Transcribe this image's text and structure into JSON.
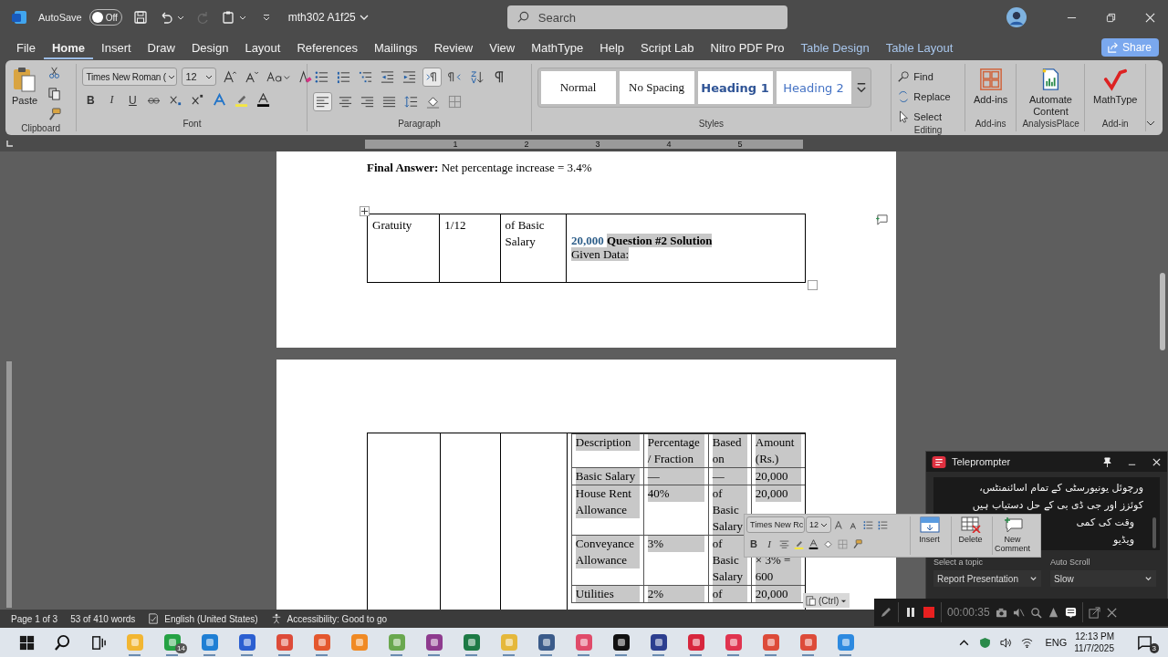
{
  "title_bar": {
    "autosave_label": "AutoSave",
    "autosave_on": false,
    "autosave_state": "Off",
    "redo_disabled": true,
    "document_name": "mth302 A1f25",
    "search_placeholder": "Search"
  },
  "tabs": [
    {
      "label": "File",
      "selected": false,
      "kind": "main"
    },
    {
      "label": "Home",
      "selected": true,
      "kind": "main"
    },
    {
      "label": "Insert",
      "selected": false,
      "kind": "main"
    },
    {
      "label": "Draw",
      "selected": false,
      "kind": "main"
    },
    {
      "label": "Design",
      "selected": false,
      "kind": "main"
    },
    {
      "label": "Layout",
      "selected": false,
      "kind": "main"
    },
    {
      "label": "References",
      "selected": false,
      "kind": "main"
    },
    {
      "label": "Mailings",
      "selected": false,
      "kind": "main"
    },
    {
      "label": "Review",
      "selected": false,
      "kind": "main"
    },
    {
      "label": "View",
      "selected": false,
      "kind": "main"
    },
    {
      "label": "MathType",
      "selected": false,
      "kind": "main"
    },
    {
      "label": "Help",
      "selected": false,
      "kind": "main"
    },
    {
      "label": "Script Lab",
      "selected": false,
      "kind": "main"
    },
    {
      "label": "Nitro PDF Pro",
      "selected": false,
      "kind": "main"
    },
    {
      "label": "Table Design",
      "selected": false,
      "kind": "contextual"
    },
    {
      "label": "Table Layout",
      "selected": false,
      "kind": "contextual"
    }
  ],
  "share_label": "Share",
  "ribbon": {
    "clipboard": {
      "paste_label": "Paste",
      "group_label": "Clipboard"
    },
    "font": {
      "font_name": "Times New Roman (",
      "font_size": "12",
      "bold": "B",
      "italic": "I",
      "underline": "U",
      "group_label": "Font"
    },
    "paragraph": {
      "group_label": "Paragraph",
      "align_left_on": true,
      "ltr_on": true
    },
    "styles": {
      "items": [
        {
          "label": "Normal",
          "kind": "normal"
        },
        {
          "label": "No Spacing",
          "kind": "normal"
        },
        {
          "label": "Heading 1",
          "kind": "heading1"
        },
        {
          "label": "Heading 2",
          "kind": "heading2"
        }
      ],
      "group_label": "Styles"
    },
    "editing": {
      "find": "Find",
      "replace": "Replace",
      "select": "Select",
      "group_label": "Editing"
    },
    "addins": [
      {
        "label": "Add-ins",
        "group": "Add-ins",
        "kind": "addins"
      },
      {
        "label": "Automate Content",
        "group": "AnalysisPlace",
        "kind": "automate"
      },
      {
        "label": "MathType",
        "group": "Add-in",
        "kind": "mathtype"
      }
    ]
  },
  "ruler": {
    "marks": [
      "1",
      "2",
      "3",
      "4",
      "5"
    ]
  },
  "document": {
    "final_answer": "**Final Answer:** Net percentage increase = 3.4%",
    "upper_table": {
      "cells": [
        "Gratuity",
        "1/12",
        "of Basic Salary"
      ],
      "amount": "20,000",
      "heading": "Question #2 Solution",
      "given": "Given Data:",
      "selected": true
    },
    "lower_table": {
      "selected": true,
      "header": [
        "Description",
        "Percentage / Fraction",
        "Based on",
        "Amount (Rs.)"
      ],
      "rows": [
        {
          "kind": "fixed",
          "cells": [
            "Basic Salary",
            "—",
            "—",
            "20,000"
          ]
        },
        {
          "kind": "percentage",
          "cells": [
            "House Rent Allowance",
            "40%",
            "of Basic Salary",
            "20,000"
          ]
        },
        {
          "kind": "computed",
          "cells": [
            "Conveyance Allowance",
            "3%",
            "of Basic Salary",
            "× 3% = 600"
          ]
        },
        {
          "kind": "percentage",
          "cells": [
            "Utilities",
            "2%",
            "of",
            "20,000"
          ]
        }
      ]
    }
  },
  "mini_toolbar": {
    "font_name": "Times New Rc",
    "font_size": "12",
    "bold": "B",
    "italic": "I",
    "insert": "Insert",
    "delete": "Delete",
    "new_comment": "New Comment"
  },
  "paste_options": "(Ctrl)",
  "teleprompter": {
    "title": "Teleprompter",
    "lines": [
      "ورچوئل یونیورسٹی کے تمام اسائنمنٹس،",
      "کوئزز اور جی ڈی بی کے حل دستیاب ہیں",
      "وقت کی کمی",
      "ویڈیو"
    ],
    "topic_label": "Select a topic",
    "topic": "Report Presentation",
    "scroll_label": "Auto Scroll",
    "scroll": "Slow"
  },
  "recorder": {
    "time": "00:00:35"
  },
  "status_bar": {
    "page": "Page 1 of 3",
    "words": "53 of 410 words",
    "language": "English (United States)",
    "accessibility": "Accessibility: Good to go"
  },
  "taskbar": {
    "apps": [
      {
        "running": true
      },
      {
        "running": true,
        "badge": "14"
      },
      {
        "running": true
      },
      {
        "running": true
      },
      {
        "running": true
      },
      {
        "running": true
      },
      {
        "running": false
      },
      {
        "running": true
      },
      {
        "running": true
      },
      {
        "running": true
      },
      {
        "running": true
      },
      {
        "running": true
      },
      {
        "running": true
      },
      {
        "running": true
      },
      {
        "running": true
      },
      {
        "running": true
      },
      {
        "running": true
      },
      {
        "running": true
      },
      {
        "running": true
      },
      {
        "running": true
      }
    ],
    "language": "ENG",
    "time": "12:13 PM",
    "date": "11/7/2025",
    "notifications": "3"
  }
}
